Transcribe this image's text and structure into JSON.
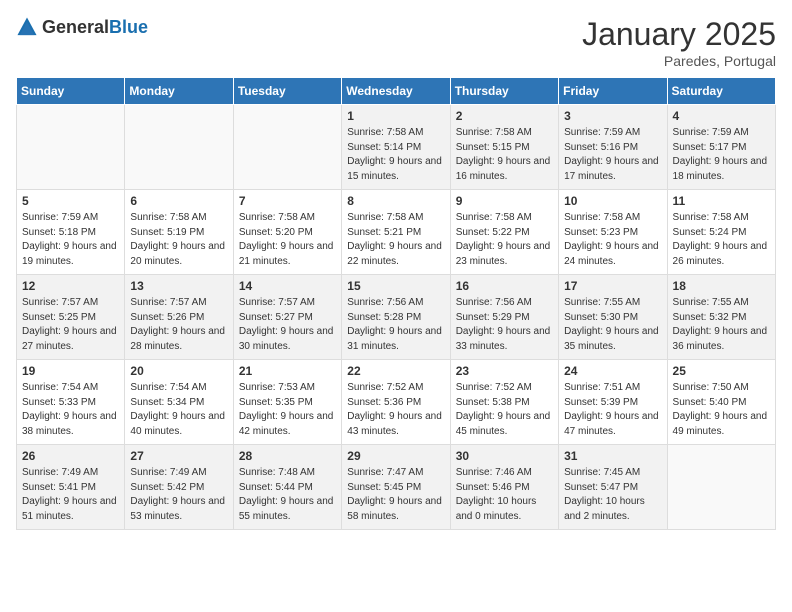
{
  "header": {
    "logo_general": "General",
    "logo_blue": "Blue",
    "month": "January 2025",
    "location": "Paredes, Portugal"
  },
  "weekdays": [
    "Sunday",
    "Monday",
    "Tuesday",
    "Wednesday",
    "Thursday",
    "Friday",
    "Saturday"
  ],
  "weeks": [
    [
      {
        "day": "",
        "empty": true
      },
      {
        "day": "",
        "empty": true
      },
      {
        "day": "",
        "empty": true
      },
      {
        "day": "1",
        "sunrise": "7:58 AM",
        "sunset": "5:14 PM",
        "daylight": "9 hours and 15 minutes."
      },
      {
        "day": "2",
        "sunrise": "7:58 AM",
        "sunset": "5:15 PM",
        "daylight": "9 hours and 16 minutes."
      },
      {
        "day": "3",
        "sunrise": "7:59 AM",
        "sunset": "5:16 PM",
        "daylight": "9 hours and 17 minutes."
      },
      {
        "day": "4",
        "sunrise": "7:59 AM",
        "sunset": "5:17 PM",
        "daylight": "9 hours and 18 minutes."
      }
    ],
    [
      {
        "day": "5",
        "sunrise": "7:59 AM",
        "sunset": "5:18 PM",
        "daylight": "9 hours and 19 minutes."
      },
      {
        "day": "6",
        "sunrise": "7:58 AM",
        "sunset": "5:19 PM",
        "daylight": "9 hours and 20 minutes."
      },
      {
        "day": "7",
        "sunrise": "7:58 AM",
        "sunset": "5:20 PM",
        "daylight": "9 hours and 21 minutes."
      },
      {
        "day": "8",
        "sunrise": "7:58 AM",
        "sunset": "5:21 PM",
        "daylight": "9 hours and 22 minutes."
      },
      {
        "day": "9",
        "sunrise": "7:58 AM",
        "sunset": "5:22 PM",
        "daylight": "9 hours and 23 minutes."
      },
      {
        "day": "10",
        "sunrise": "7:58 AM",
        "sunset": "5:23 PM",
        "daylight": "9 hours and 24 minutes."
      },
      {
        "day": "11",
        "sunrise": "7:58 AM",
        "sunset": "5:24 PM",
        "daylight": "9 hours and 26 minutes."
      }
    ],
    [
      {
        "day": "12",
        "sunrise": "7:57 AM",
        "sunset": "5:25 PM",
        "daylight": "9 hours and 27 minutes."
      },
      {
        "day": "13",
        "sunrise": "7:57 AM",
        "sunset": "5:26 PM",
        "daylight": "9 hours and 28 minutes."
      },
      {
        "day": "14",
        "sunrise": "7:57 AM",
        "sunset": "5:27 PM",
        "daylight": "9 hours and 30 minutes."
      },
      {
        "day": "15",
        "sunrise": "7:56 AM",
        "sunset": "5:28 PM",
        "daylight": "9 hours and 31 minutes."
      },
      {
        "day": "16",
        "sunrise": "7:56 AM",
        "sunset": "5:29 PM",
        "daylight": "9 hours and 33 minutes."
      },
      {
        "day": "17",
        "sunrise": "7:55 AM",
        "sunset": "5:30 PM",
        "daylight": "9 hours and 35 minutes."
      },
      {
        "day": "18",
        "sunrise": "7:55 AM",
        "sunset": "5:32 PM",
        "daylight": "9 hours and 36 minutes."
      }
    ],
    [
      {
        "day": "19",
        "sunrise": "7:54 AM",
        "sunset": "5:33 PM",
        "daylight": "9 hours and 38 minutes."
      },
      {
        "day": "20",
        "sunrise": "7:54 AM",
        "sunset": "5:34 PM",
        "daylight": "9 hours and 40 minutes."
      },
      {
        "day": "21",
        "sunrise": "7:53 AM",
        "sunset": "5:35 PM",
        "daylight": "9 hours and 42 minutes."
      },
      {
        "day": "22",
        "sunrise": "7:52 AM",
        "sunset": "5:36 PM",
        "daylight": "9 hours and 43 minutes."
      },
      {
        "day": "23",
        "sunrise": "7:52 AM",
        "sunset": "5:38 PM",
        "daylight": "9 hours and 45 minutes."
      },
      {
        "day": "24",
        "sunrise": "7:51 AM",
        "sunset": "5:39 PM",
        "daylight": "9 hours and 47 minutes."
      },
      {
        "day": "25",
        "sunrise": "7:50 AM",
        "sunset": "5:40 PM",
        "daylight": "9 hours and 49 minutes."
      }
    ],
    [
      {
        "day": "26",
        "sunrise": "7:49 AM",
        "sunset": "5:41 PM",
        "daylight": "9 hours and 51 minutes."
      },
      {
        "day": "27",
        "sunrise": "7:49 AM",
        "sunset": "5:42 PM",
        "daylight": "9 hours and 53 minutes."
      },
      {
        "day": "28",
        "sunrise": "7:48 AM",
        "sunset": "5:44 PM",
        "daylight": "9 hours and 55 minutes."
      },
      {
        "day": "29",
        "sunrise": "7:47 AM",
        "sunset": "5:45 PM",
        "daylight": "9 hours and 58 minutes."
      },
      {
        "day": "30",
        "sunrise": "7:46 AM",
        "sunset": "5:46 PM",
        "daylight": "10 hours and 0 minutes."
      },
      {
        "day": "31",
        "sunrise": "7:45 AM",
        "sunset": "5:47 PM",
        "daylight": "10 hours and 2 minutes."
      },
      {
        "day": "",
        "empty": true
      }
    ]
  ]
}
